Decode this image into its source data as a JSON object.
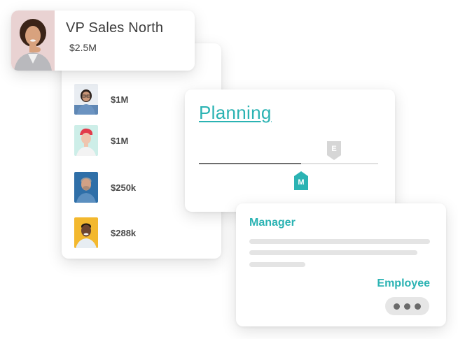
{
  "vp": {
    "title": "VP Sales North",
    "amount": "$2.5M"
  },
  "team": [
    {
      "value": "$1M",
      "avatar": "woman-glasses-avatar"
    },
    {
      "value": "$1M",
      "avatar": "woman-red-hair-avatar"
    },
    {
      "value": "$250k",
      "avatar": "man-grey-hair-avatar"
    },
    {
      "value": "$288k",
      "avatar": "man-yellow-background-avatar"
    }
  ],
  "planning": {
    "title": "Planning",
    "employee_marker": "E",
    "manager_marker": "M",
    "progress": 0.57
  },
  "review": {
    "manager_label": "Manager",
    "employee_label": "Employee",
    "more_icon": "more-dots-icon"
  },
  "colors": {
    "accent": "#2bb3b3",
    "marker_muted": "#d6d6d6",
    "text": "#3d3d3d"
  }
}
